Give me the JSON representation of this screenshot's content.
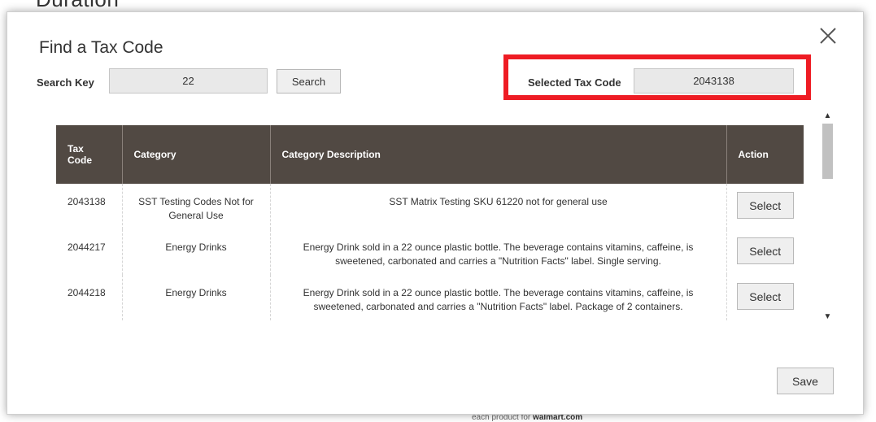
{
  "background": {
    "heading": "Duration",
    "footer_prefix": "each product for ",
    "footer_bold": "walmart.com"
  },
  "modal": {
    "title": "Find a Tax Code",
    "close_icon": "close-icon",
    "search_label": "Search Key",
    "search_value": "22",
    "search_button": "Search",
    "selected_label": "Selected Tax Code",
    "selected_value": "2043138",
    "save_button": "Save",
    "highlight_color": "#ee1c24"
  },
  "table": {
    "header_color": "#514943",
    "columns": [
      "Tax Code",
      "Category",
      "Category Description",
      "Action"
    ],
    "rows": [
      {
        "code": "2043138",
        "category": "SST Testing Codes Not for General Use",
        "description": "SST Matrix Testing SKU 61220 not for general use",
        "action": "Select"
      },
      {
        "code": "2044217",
        "category": "Energy Drinks",
        "description": "Energy Drink sold in a 22 ounce plastic bottle. The beverage contains vitamins, caffeine, is sweetened, carbonated and carries a \"Nutrition Facts\" label. Single serving.",
        "action": "Select"
      },
      {
        "code": "2044218",
        "category": "Energy Drinks",
        "description": "Energy Drink sold in a 22 ounce plastic bottle. The beverage contains vitamins, caffeine, is sweetened, carbonated and carries a \"Nutrition Facts\" label. Package of 2 containers.",
        "action": "Select"
      }
    ]
  }
}
